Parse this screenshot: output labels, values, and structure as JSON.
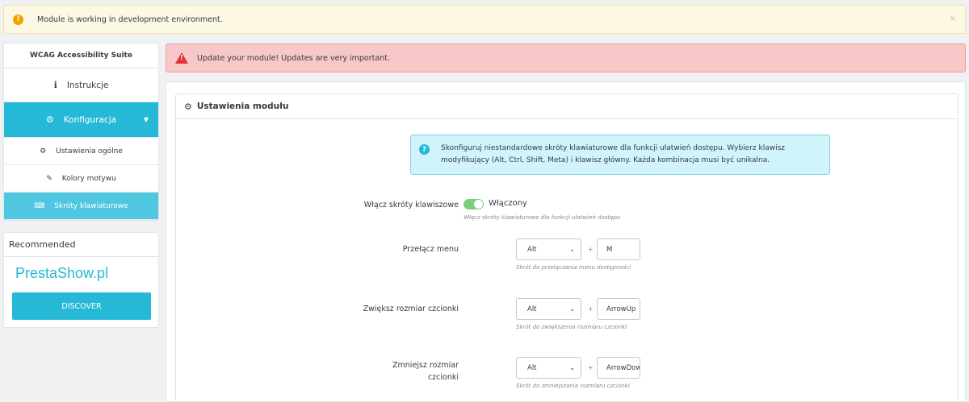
{
  "dev_alert": {
    "text": "Module is working in development environment.",
    "close": "×"
  },
  "update_alert": {
    "text": "Update your module! Updates are very important."
  },
  "sidebar": {
    "title": "WCAG Accessibility Suite",
    "instrukcje": "Instrukcje",
    "konfiguracja": "Konfiguracja",
    "sub_items": [
      "Ustawienia ogólne",
      "Kolory motywu",
      "Skróty klawiaturowe"
    ],
    "recommended": "Recommended",
    "brand": "PrestaShow.pl",
    "discover": "DISCOVER"
  },
  "panel": {
    "title": "Ustawienia modułu",
    "info": "Skonfiguruj niestandardowe skróty klawiaturowe dla funkcji ułatwień dostępu. Wybierz klawisz modyfikujący (Alt, Ctrl, Shift, Meta) i klawisz główny. Każda kombinacja musi być unikalna.",
    "enable": {
      "label": "Włącz skróty klawiszowe",
      "state": "Włączony",
      "help": "Włącz skróty klawiaturowe dla funkcji ułatwień dostępu"
    },
    "shortcuts": [
      {
        "label": "Przełącz menu",
        "modifier": "Alt",
        "key": "M",
        "help": "Skrót do przełączania menu dostępności"
      },
      {
        "label": "Zwiększ rozmiar czcionki",
        "modifier": "Alt",
        "key": "ArrowUp",
        "help": "Skrót do zwiększenia rozmiaru czcionki"
      },
      {
        "label": "Zmniejsz rozmiar czcionki",
        "modifier": "Alt",
        "key": "ArrowDown",
        "help": "Skrót do zmniejszania rozmiaru czcionki"
      }
    ],
    "plus": "+"
  },
  "colors": {
    "accent": "#25b9d7",
    "switch_on": "#78d07d",
    "danger": "#e2333a",
    "warning": "#f0a300"
  },
  "icons": [
    "warning-icon",
    "close-icon",
    "info-circle-icon",
    "gear-icon",
    "brush-icon",
    "keyboard-icon",
    "cogs-icon",
    "question-circle-icon",
    "chevron-down-icon"
  ]
}
